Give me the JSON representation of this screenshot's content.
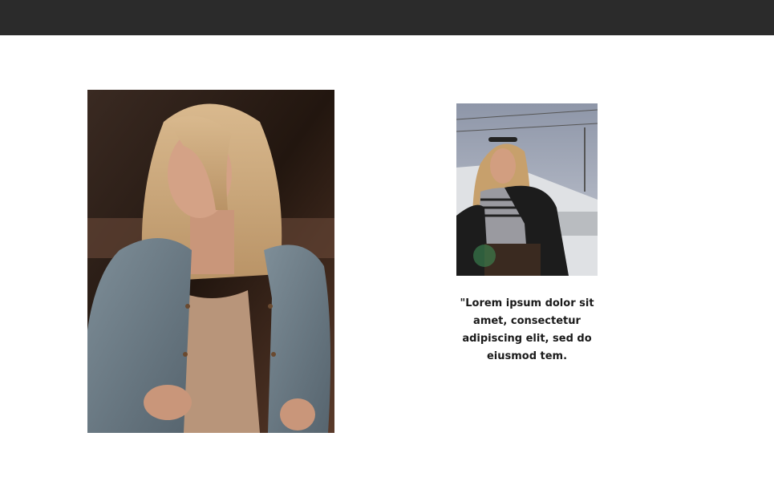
{
  "header": {
    "color": "#2b2b2b"
  },
  "gallery": {
    "main_image": {
      "icon": "portrait-photo-icon",
      "subject": "woman in denim jacket"
    },
    "side_image": {
      "icon": "portrait-photo-icon",
      "subject": "woman with sunglasses by car"
    }
  },
  "testimonial": {
    "quote": "\"Lorem ipsum dolor sit amet, consectetur adipiscing elit, sed do eiusmod tem."
  },
  "colors": {
    "background": "#ffffff",
    "text": "#1a1a1a"
  }
}
